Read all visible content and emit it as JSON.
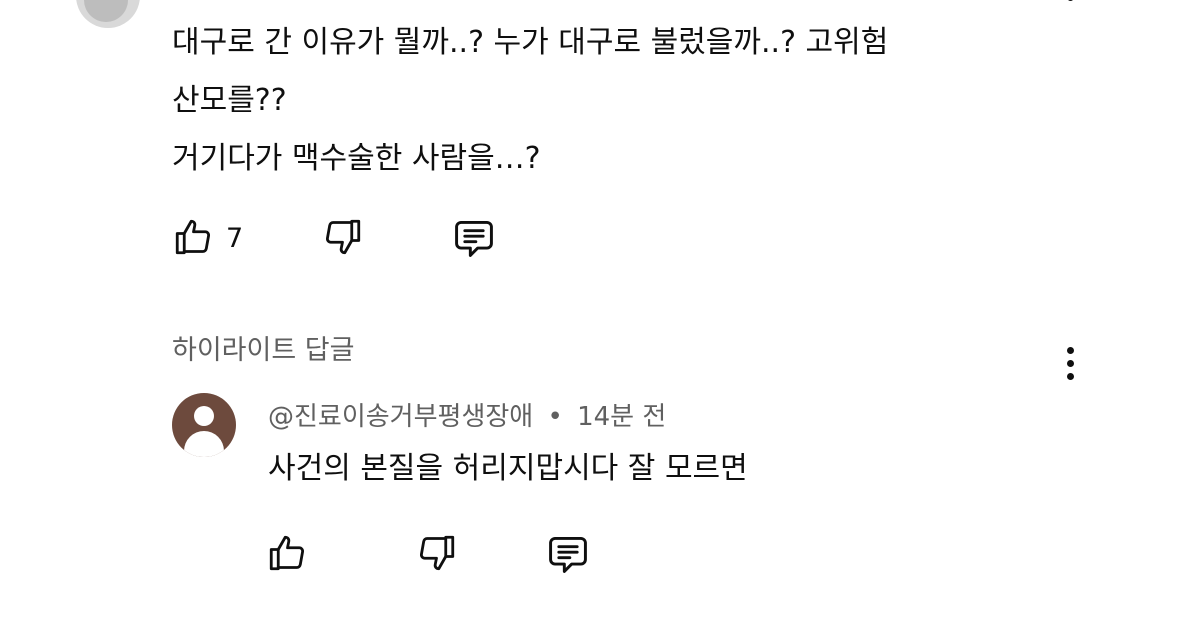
{
  "parent_comment": {
    "lines": [
      "대구로 간 이유가 뭘까..? 누가 대구로 불렀을까..? 고위험",
      "산모를??",
      "거기다가 맥수술한 사람을…?"
    ],
    "like_count": "7"
  },
  "highlighted_replies_label": "하이라이트 답글",
  "reply": {
    "author": "@진료이송거부평생장애",
    "separator": "•",
    "time": "14분 전",
    "text": "사건의 본질을 허리지맙시다 잘 모르면"
  },
  "icons": {
    "like": "thumbs-up-icon",
    "dislike": "thumbs-down-icon",
    "reply": "comment-icon",
    "more": "more-vert-icon"
  },
  "colors": {
    "text_primary": "#0f0f0f",
    "text_secondary": "#606060",
    "reply_avatar": "#6d4a3d",
    "background": "#ffffff"
  }
}
